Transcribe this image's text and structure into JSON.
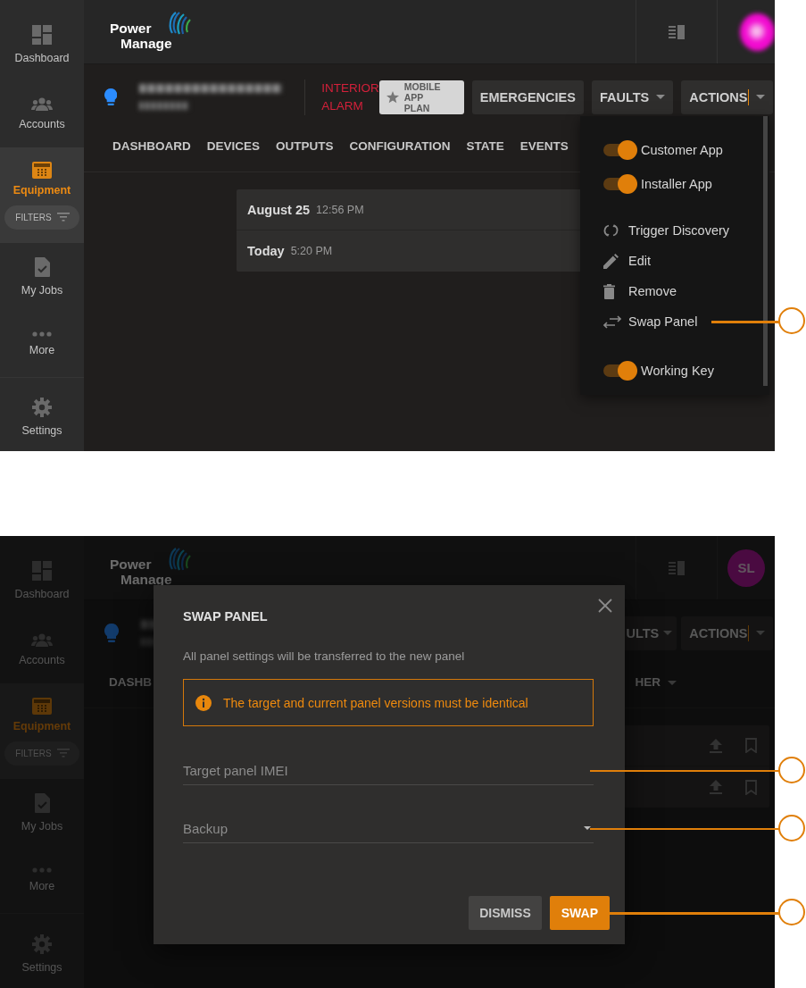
{
  "screens": [
    {
      "dimmed": false,
      "sidebar": {
        "items": [
          {
            "label": "Dashboard",
            "selected": false
          },
          {
            "label": "Accounts",
            "selected": false
          },
          {
            "label": "Equipment",
            "selected": true,
            "filter_label": "FILTERS"
          },
          {
            "label": "My Jobs",
            "selected": false
          },
          {
            "label": "More",
            "selected": false
          },
          {
            "label": "Settings",
            "selected": false
          }
        ]
      },
      "logo": {
        "lines": [
          "Power",
          "Manage"
        ]
      },
      "avatar": {
        "kind": "blurred"
      },
      "device": {
        "alarm": "INTERIOR ALARM"
      },
      "buttons": [
        {
          "label": "MOBILE APP PLAN",
          "kind": "plan"
        },
        {
          "label": "EMERGENCIES",
          "kind": "plain"
        },
        {
          "label": "FAULTS",
          "kind": "dropdown",
          "cursor": false
        },
        {
          "label": "ACTIONS",
          "kind": "dropdown",
          "cursor": true
        }
      ],
      "tabs": [
        {
          "label": "DASHBOARD",
          "kind": "plain"
        },
        {
          "label": "DEVICES",
          "kind": "plain"
        },
        {
          "label": "OUTPUTS",
          "kind": "plain"
        },
        {
          "label": "CONFIGURATION",
          "kind": "plain"
        },
        {
          "label": "STATE",
          "kind": "plain"
        },
        {
          "label": "EVENTS",
          "kind": "plain"
        }
      ],
      "rows": [
        {
          "kind": "entry",
          "date": "August 25",
          "time": "12:56 PM"
        },
        {
          "kind": "entry",
          "date": "Today",
          "time": "5:20 PM"
        }
      ],
      "menu": {
        "items": [
          {
            "kind": "toggle",
            "label": "Customer App",
            "on": true,
            "callout": false
          },
          {
            "kind": "toggle",
            "label": "Installer App",
            "on": true,
            "callout": false
          },
          {
            "kind": "action",
            "label": "Trigger Discovery",
            "callout": false
          },
          {
            "kind": "action",
            "label": "Edit",
            "callout": false
          },
          {
            "kind": "action",
            "label": "Remove",
            "callout": false
          },
          {
            "kind": "action",
            "label": "Swap Panel",
            "callout": true
          },
          {
            "kind": "toggle",
            "label": "Working Key",
            "on": true,
            "callout": false
          }
        ]
      }
    },
    {
      "dimmed": true,
      "sidebar": {
        "items": [
          {
            "label": "Dashboard",
            "selected": false
          },
          {
            "label": "Accounts",
            "selected": false
          },
          {
            "label": "Equipment",
            "selected": true,
            "filter_label": "FILTERS"
          },
          {
            "label": "My Jobs",
            "selected": false
          },
          {
            "label": "More",
            "selected": false
          },
          {
            "label": "Settings",
            "selected": false
          }
        ]
      },
      "logo": {
        "lines": [
          "Power",
          "Manage"
        ]
      },
      "avatar": {
        "kind": "initials",
        "initials": "SL"
      },
      "buttons": [
        {
          "label": "ULTS",
          "kind": "dropdown",
          "cursor": false
        },
        {
          "label": "ACTIONS",
          "kind": "dropdown",
          "cursor": true
        }
      ],
      "tabs": [
        {
          "label": "DASHB",
          "kind": "plain"
        },
        {
          "label": "HER",
          "kind": "dropdown"
        }
      ],
      "rows": [
        {
          "kind": "covered"
        },
        {
          "kind": "covered"
        }
      ],
      "dialog": {
        "title": "SWAP PANEL",
        "text": "All panel settings will be transferred to the new panel",
        "warning": "The target and current panel versions must be identical",
        "fields": [
          {
            "kind": "text",
            "placeholder": "Target panel IMEI",
            "callout": true
          },
          {
            "kind": "select",
            "placeholder": "Backup",
            "callout": true
          }
        ],
        "buttons": [
          {
            "label": "DISMISS",
            "kind": "secondary",
            "callout": false
          },
          {
            "label": "SWAP",
            "kind": "primary",
            "callout": true
          }
        ]
      }
    }
  ]
}
